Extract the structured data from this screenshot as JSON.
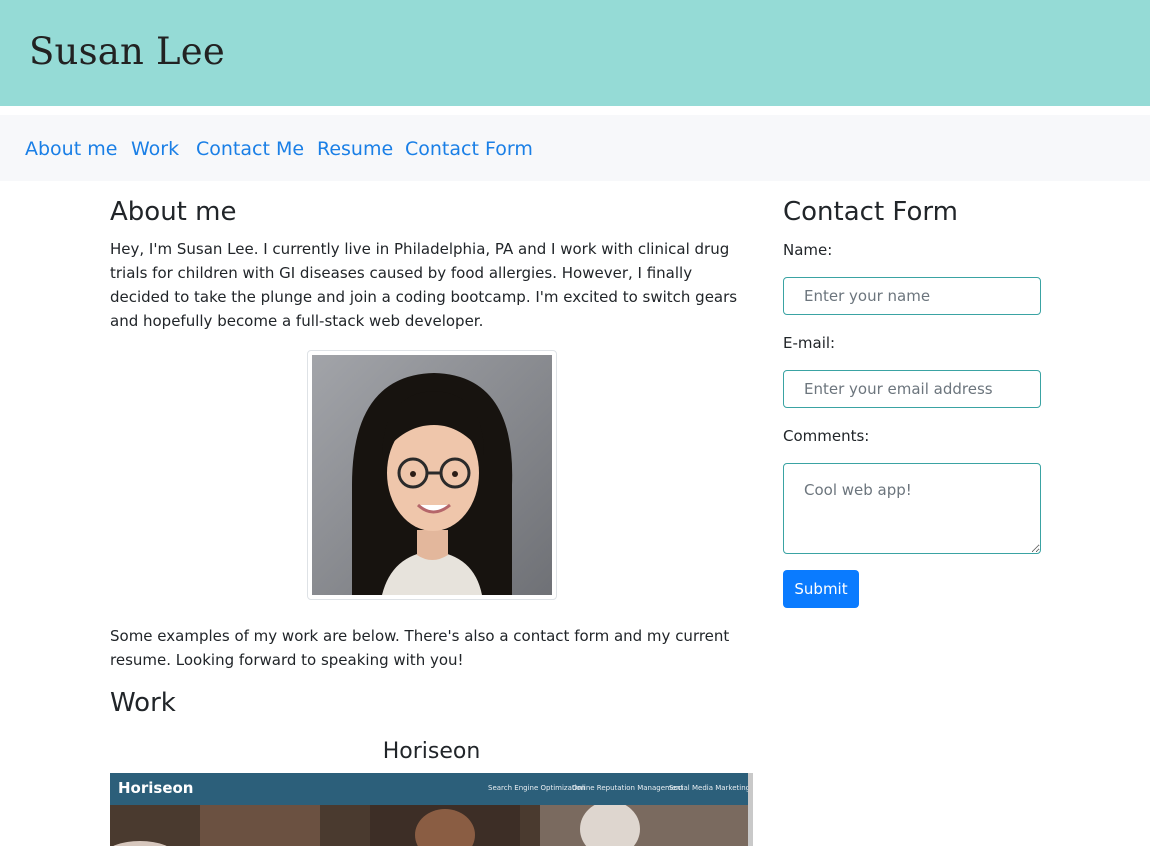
{
  "header": {
    "title": "Susan Lee"
  },
  "nav": {
    "items": [
      "About me",
      "Work",
      "Contact Me",
      "Resume",
      "Contact Form"
    ]
  },
  "about": {
    "heading": "About me",
    "intro": "Hey, I'm Susan Lee. I currently live in Philadelphia, PA and I work with clinical drug trials for children with GI diseases caused by food allergies. However, I finally decided to take the plunge and join a coding bootcamp. I'm excited to switch gears and hopefully become a full-stack web developer.",
    "outro": "Some examples of my work are below. There's also a contact form and my current resume. Looking forward to speaking with you!"
  },
  "work": {
    "heading": "Work",
    "projects": [
      {
        "title": "Horiseon",
        "screenshot": {
          "logo": "Horiseon",
          "links": [
            "Search Engine Optimization",
            "Online Reputation Management",
            "Social Media Marketing"
          ]
        }
      }
    ]
  },
  "contact_form": {
    "heading": "Contact Form",
    "name_label": "Name:",
    "name_placeholder": "Enter your name",
    "email_label": "E-mail:",
    "email_placeholder": "Enter your email address",
    "comments_label": "Comments:",
    "comments_placeholder": "Cool web app!",
    "submit_label": "Submit"
  },
  "colors": {
    "header_bg": "#95dbd6",
    "nav_link": "#1a7fe6",
    "submit_bg": "#0a7bff",
    "input_border": "#3aa3a3"
  }
}
